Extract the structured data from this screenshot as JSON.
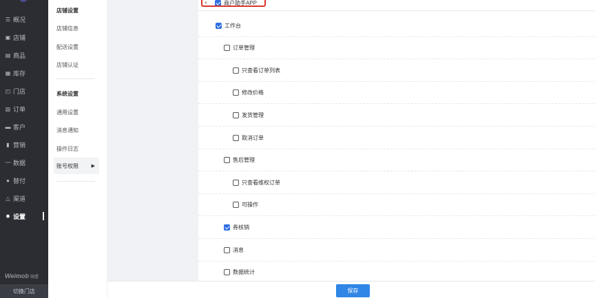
{
  "nav": {
    "items": [
      {
        "label": "概况",
        "icon": "overview-icon"
      },
      {
        "label": "店铺",
        "icon": "store-icon"
      },
      {
        "label": "商品",
        "icon": "goods-icon"
      },
      {
        "label": "库存",
        "icon": "inventory-icon"
      },
      {
        "label": "门店",
        "icon": "shop-icon"
      },
      {
        "label": "订单",
        "icon": "order-icon"
      },
      {
        "label": "客户",
        "icon": "customer-icon"
      },
      {
        "label": "营销",
        "icon": "marketing-icon"
      },
      {
        "label": "数据",
        "icon": "data-icon"
      },
      {
        "label": "替付",
        "icon": "pay-icon"
      },
      {
        "label": "渠道",
        "icon": "channel-icon"
      },
      {
        "label": "设置",
        "icon": "settings-icon"
      }
    ],
    "active": "设置",
    "brand": "Weimob",
    "brand_sub": "微盟",
    "switch_store": "切换门店"
  },
  "subnav": {
    "group1": "店铺设置",
    "group1_items": [
      "店铺信息",
      "配送设置",
      "店铺认证"
    ],
    "group2": "系统设置",
    "group2_items": [
      "通用设置",
      "消息通知",
      "操作日志"
    ],
    "active_item": "账号权限"
  },
  "permissions": {
    "root": {
      "label": "商户助手APP",
      "checked": true
    },
    "rows": [
      {
        "label": "工作台",
        "level": 1,
        "checked": true
      },
      {
        "label": "订单管理",
        "level": 2,
        "checked": false
      },
      {
        "label": "只查看订单列表",
        "level": 3,
        "checked": false
      },
      {
        "label": "修改价格",
        "level": 3,
        "checked": false
      },
      {
        "label": "发货管理",
        "level": 3,
        "checked": false
      },
      {
        "label": "取消订单",
        "level": 3,
        "checked": false
      },
      {
        "label": "售后管理",
        "level": 2,
        "checked": false
      },
      {
        "label": "只查看维权订单",
        "level": 3,
        "checked": false
      },
      {
        "label": "可操作",
        "level": 3,
        "checked": false
      },
      {
        "label": "券核销",
        "level": 2,
        "checked": true
      },
      {
        "label": "消息",
        "level": 2,
        "checked": false
      },
      {
        "label": "数据统计",
        "level": 2,
        "checked": false
      }
    ]
  },
  "footer": {
    "save_label": "保存"
  },
  "colors": {
    "accent": "#2f86e6",
    "checkbox": "#2f6fe4",
    "highlight": "#d9362b",
    "sidebar": "#2c2d33"
  }
}
